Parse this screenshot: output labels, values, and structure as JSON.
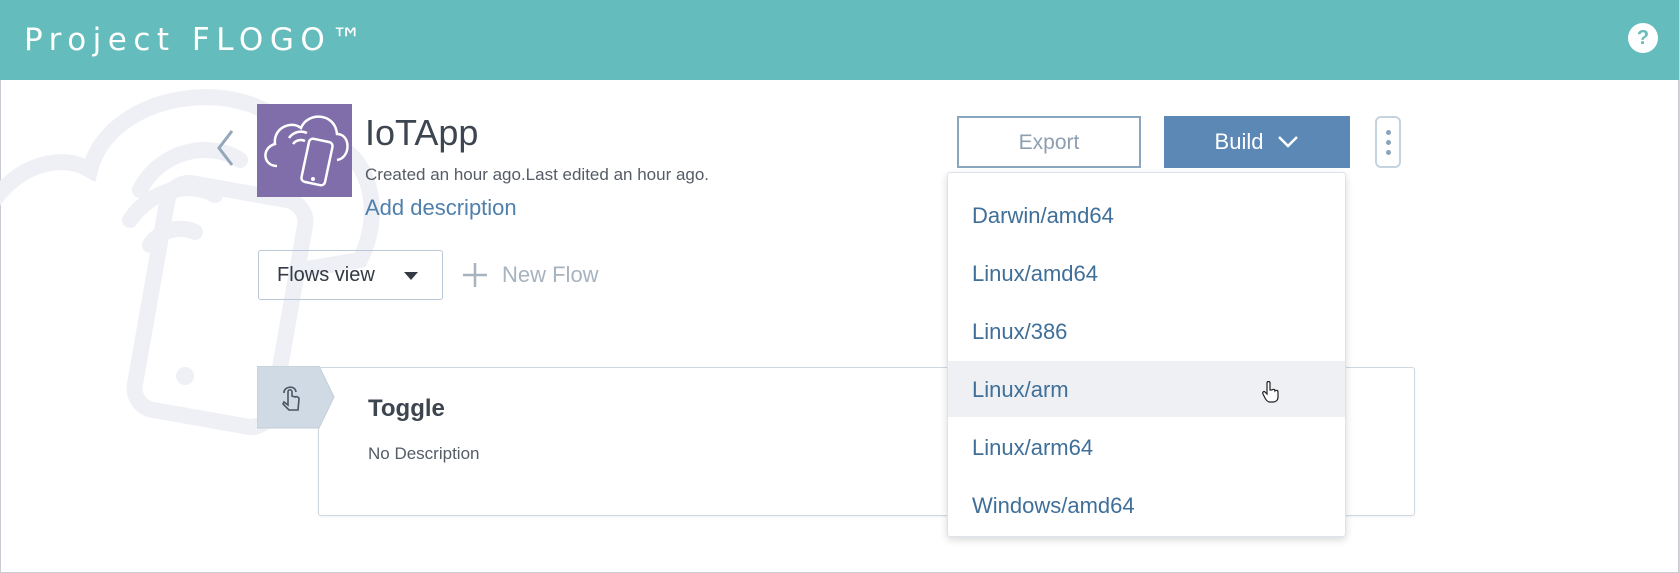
{
  "header": {
    "brand": "Project FLOGO™",
    "help_icon": "question-mark-icon",
    "bg_color": "#64bcbc"
  },
  "app": {
    "name": "IoTApp",
    "meta": "Created an hour ago.Last edited an hour ago.",
    "add_description": "Add description",
    "logo_icon": "cloud-phone-icon",
    "logo_color": "#7f6ea9"
  },
  "toolbar": {
    "export_label": "Export",
    "build_label": "Build",
    "more_icon": "vertical-ellipsis-icon",
    "accent": "#5c88b6"
  },
  "view_select": {
    "selected": "Flows view"
  },
  "new_flow_label": "New Flow",
  "flows": [
    {
      "title": "Toggle",
      "description": "No Description",
      "trigger_icon": "touch-pointer-icon"
    }
  ],
  "build_menu": {
    "items": [
      "Darwin/amd64",
      "Linux/amd64",
      "Linux/386",
      "Linux/arm",
      "Linux/arm64",
      "Windows/amd64"
    ],
    "hovered": "Linux/arm"
  }
}
